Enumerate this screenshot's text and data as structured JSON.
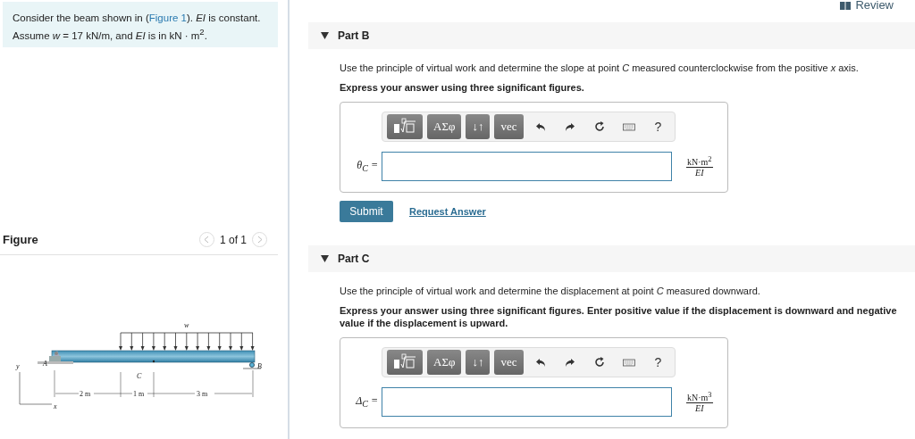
{
  "review": {
    "label": "Review"
  },
  "intro": {
    "before": "Consider the beam shown in (",
    "link": "Figure 1",
    "after": "). *EI* is constant. Assume *w* = 17 kN/m, and *EI* is in kN · m$^{2}$."
  },
  "figure": {
    "title": "Figure",
    "pager": "1 of 1",
    "labels": {
      "load": "w",
      "support_a": "A",
      "support_b": "B",
      "point": "C",
      "y_axis": "y",
      "x_axis": "x",
      "dim_1": "2 m",
      "dim_2": "1 m",
      "dim_3": "3 m"
    }
  },
  "parts": [
    {
      "title": "Part B",
      "expanded": true,
      "prompt": "Use the principle of virtual work and determine the slope at point *C* measured counterclockwise from the positive *x* axis.",
      "instruction": "Express your answer using three significant figures.",
      "toolbar": [
        {
          "kind": "templates"
        },
        {
          "kind": "text",
          "label": "ΑΣφ"
        },
        {
          "kind": "text",
          "label": "↓↑"
        },
        {
          "kind": "text",
          "label": "vec"
        },
        {
          "kind": "undo"
        },
        {
          "kind": "redo"
        },
        {
          "kind": "reset"
        },
        {
          "kind": "keyboard"
        },
        {
          "kind": "help",
          "label": "?"
        }
      ],
      "variable": "θ$_{C}$ =",
      "unit_numerator": "kN·m$^{2}$",
      "unit_denominator": "EI",
      "buttons": {
        "submit": "Submit",
        "request": "Request Answer"
      }
    },
    {
      "title": "Part C",
      "expanded": true,
      "prompt": "Use the principle of virtual work and determine the displacement at point *C* measured downward.",
      "instruction": "Express your answer using three significant figures. Enter positive value if the displacement is downward and negative value if the displacement is upward.",
      "toolbar": [
        {
          "kind": "templates"
        },
        {
          "kind": "text",
          "label": "ΑΣφ"
        },
        {
          "kind": "text",
          "label": "↓↑"
        },
        {
          "kind": "text",
          "label": "vec"
        },
        {
          "kind": "undo"
        },
        {
          "kind": "redo"
        },
        {
          "kind": "reset"
        },
        {
          "kind": "keyboard"
        },
        {
          "kind": "help",
          "label": "?"
        }
      ],
      "variable": "Δ$_{C}$ =",
      "unit_numerator": "kN·m$^{3}$",
      "unit_denominator": "EI"
    }
  ]
}
